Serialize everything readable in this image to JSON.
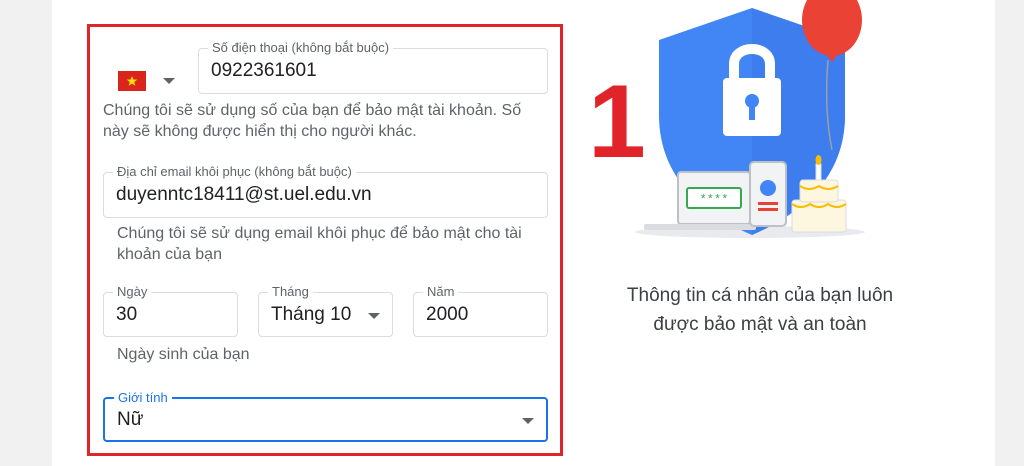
{
  "phone": {
    "country": "Vietnam",
    "label": "Số điện thoại (không bắt buộc)",
    "value": "0922361601",
    "hint_line1": "Chúng tôi sẽ sử dụng số của bạn để bảo mật tài khoản. Số",
    "hint_line2": "này sẽ không được hiển thị cho người khác."
  },
  "recovery_email": {
    "label": "Địa chỉ email khôi phục (không bắt buộc)",
    "value": "duyenntc18411@st.uel.edu.vn",
    "hint_line1": "Chúng tôi sẽ sử dụng email khôi phục để bảo mật cho tài",
    "hint_line2": "khoản của bạn"
  },
  "birthday": {
    "day_label": "Ngày",
    "day_value": "30",
    "month_label": "Tháng",
    "month_value": "Tháng 10",
    "year_label": "Năm",
    "year_value": "2000",
    "hint": "Ngày sinh của bạn"
  },
  "gender": {
    "label": "Giới tính",
    "value": "Nữ"
  },
  "annotation_number": "1",
  "illustration": {
    "password_mask": "****"
  },
  "caption": {
    "line1": "Thông tin cá nhân của bạn luôn",
    "line2": "được bảo mật và an toàn"
  },
  "colors": {
    "highlight": "#e0242a",
    "accent": "#1a73e8",
    "shield": "#4285f4",
    "balloon": "#ea4335"
  }
}
